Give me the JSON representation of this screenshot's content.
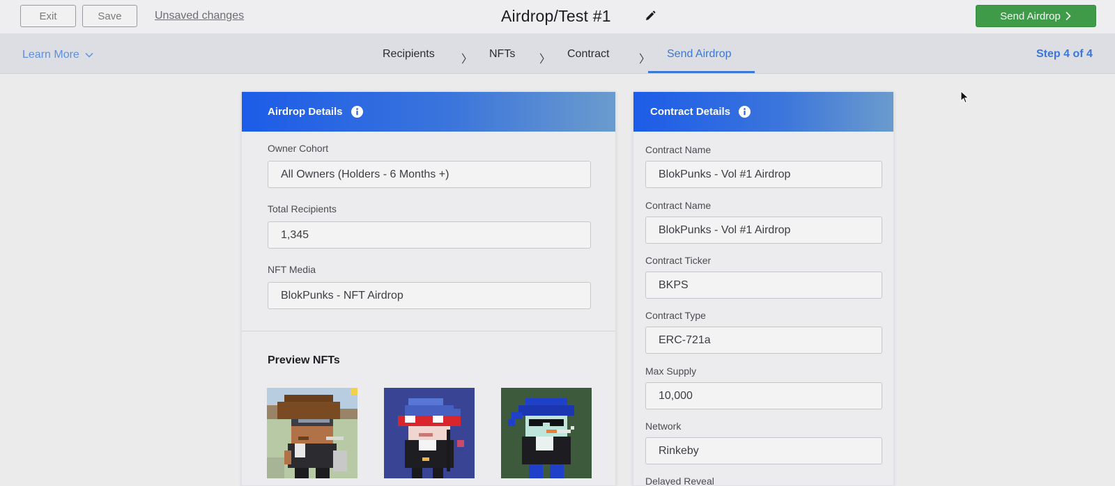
{
  "topbar": {
    "exit_label": "Exit",
    "save_label": "Save",
    "unsaved_label": "Unsaved changes",
    "title": "Airdrop/Test #1",
    "send_label": "Send Airdrop"
  },
  "stepbar": {
    "learn_more": "Learn More",
    "steps": [
      {
        "label": "Recipients",
        "active": false
      },
      {
        "label": "NFTs",
        "active": false
      },
      {
        "label": "Contract",
        "active": false
      },
      {
        "label": "Send Airdrop",
        "active": true
      }
    ],
    "separator": "〉",
    "step_count": "Step 4 of 4"
  },
  "airdrop_details": {
    "title": "Airdrop Details",
    "fields": [
      {
        "label": "Owner Cohort",
        "value": "All Owners (Holders - 6 Months +)"
      },
      {
        "label": "Total Recipients",
        "value": "1,345"
      },
      {
        "label": "NFT Media",
        "value": "BlokPunks - NFT Airdrop"
      }
    ],
    "preview_title": "Preview NFTs",
    "previews": [
      {
        "icon": "pixel-punk-cowboy"
      },
      {
        "icon": "pixel-punk-bandana"
      },
      {
        "icon": "pixel-punk-sunglasses"
      }
    ]
  },
  "contract_details": {
    "title": "Contract Details",
    "fields": [
      {
        "label": "Contract Name",
        "value": "BlokPunks - Vol #1 Airdrop"
      },
      {
        "label": "Contract Name",
        "value": "BlokPunks - Vol #1 Airdrop"
      },
      {
        "label": "Contract Ticker",
        "value": "BKPS"
      },
      {
        "label": "Contract Type",
        "value": "ERC-721a"
      },
      {
        "label": "Max Supply",
        "value": "10,000"
      },
      {
        "label": "Network",
        "value": "Rinkeby"
      },
      {
        "label": "Delayed Reveal",
        "value": ""
      }
    ]
  },
  "colors": {
    "accent_blue": "#3a77d8",
    "header_gradient_start": "#1c5ce8",
    "header_gradient_end": "#6b9bcd",
    "send_green": "#3f9b48"
  }
}
